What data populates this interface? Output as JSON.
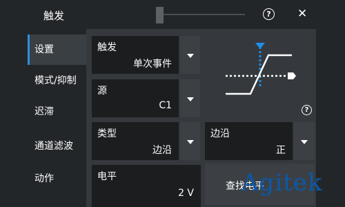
{
  "dialog": {
    "title": "触发",
    "help_glyph": "?",
    "close_glyph": "✕"
  },
  "sidebar": {
    "items": [
      {
        "label": "设置",
        "active": true
      },
      {
        "label": "模式/抑制",
        "active": false
      },
      {
        "label": "迟滞",
        "active": false
      },
      {
        "label": "通道滤波",
        "active": false
      },
      {
        "label": "动作",
        "active": false
      }
    ]
  },
  "trigger": {
    "event_label": "触发",
    "event_value": "单次事件",
    "source_label": "源",
    "source_value": "C1",
    "type_label": "类型",
    "type_value": "边沿",
    "edge_label": "边沿",
    "edge_value": "正",
    "level_label": "电平",
    "level_value": "2 V"
  },
  "preview": {
    "help_glyph": "?",
    "marker_color": "#1e8fe6",
    "line_color": "#ffffff"
  },
  "action_button": {
    "label": "查找电平"
  },
  "watermark": {
    "text": "Agitek"
  },
  "colors": {
    "accent": "#2f8fdc",
    "background": "#232629",
    "field_bg": "#1b1d1f",
    "panel_bg": "#35393d",
    "watermark": "#0a59a8"
  },
  "icons": {
    "help": "help-circle-icon",
    "close": "close-icon",
    "dropdown": "chevron-down-icon"
  }
}
